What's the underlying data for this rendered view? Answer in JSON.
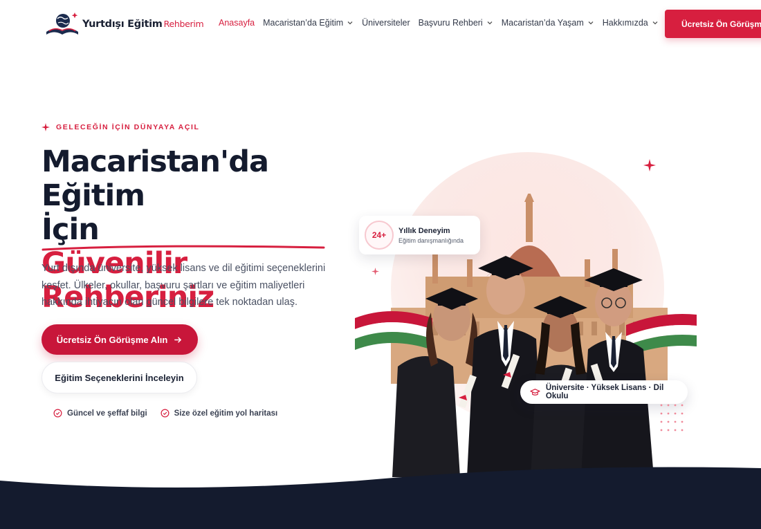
{
  "brand": {
    "name_main": "Yurtdışı Eğitim",
    "name_accent": "Rehberim",
    "primary_color": "#d71f3f",
    "dark_color": "#141b2e"
  },
  "nav": {
    "items": [
      {
        "label": "Anasayfa",
        "active": true,
        "dropdown": false
      },
      {
        "label": "Macaristan’da Eğitim",
        "active": false,
        "dropdown": true
      },
      {
        "label": "Üniversiteler",
        "active": false,
        "dropdown": false
      },
      {
        "label": "Başvuru Rehberi",
        "active": false,
        "dropdown": true
      },
      {
        "label": "Macaristan’da Yaşam",
        "active": false,
        "dropdown": true
      },
      {
        "label": "Hakkımızda",
        "active": false,
        "dropdown": true
      }
    ],
    "cta_label": "Ücretsiz Ön Görüşme"
  },
  "hero": {
    "eyebrow": "GELECEĞİN İÇİN DÜNYAYA AÇIL",
    "title_line1": "Macaristan'da Eğitim",
    "title_line2": "İçin",
    "title_highlight": "Güvenilir Rehberiniz",
    "lead": "Yurt dışında üniversite, yüksek lisans ve dil eğitimi seçeneklerini keşfet. Ülkeler, okullar, başvuru şartları ve eğitim maliyetleri hakkında ihtiyacın olan güncel bilgilere tek noktadan ulaş.",
    "primary_button": "Ücretsiz Ön Görüşme Alın",
    "secondary_button": "Eğitim Seçeneklerini İnceleyin",
    "checks": [
      "Güncel ve şeffaf bilgi",
      "Size özel eğitim yol haritası"
    ]
  },
  "badge": {
    "number": "24+",
    "title": "Yıllık Deneyim",
    "subtitle": "Eğitim danışmanlığında"
  },
  "pill": {
    "label": "Üniversite · Yüksek Lisans · Dil Okulu"
  },
  "icons": {
    "logo": "globe-book-icon",
    "sparkle": "sparkle-icon",
    "check": "check-circle-icon",
    "arrow": "arrow-right-icon",
    "cap": "graduation-cap-icon",
    "chevron": "chevron-down-icon"
  }
}
